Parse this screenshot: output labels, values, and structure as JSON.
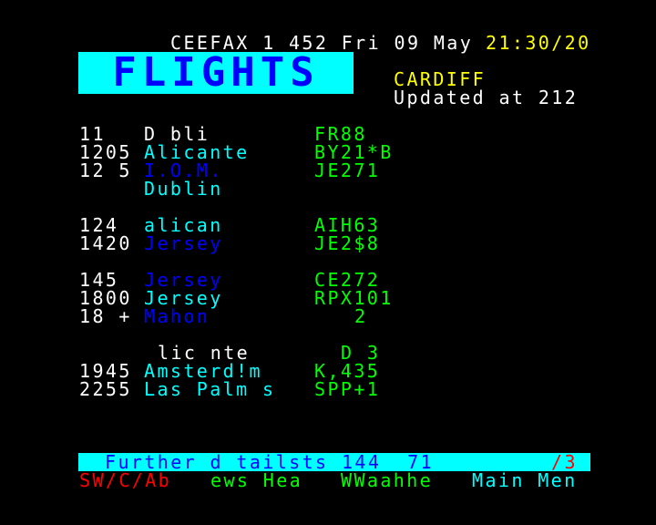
{
  "header": {
    "service": "CEEFAX 1 452 Fri 09 May",
    "time": "21:30/20"
  },
  "logo": {
    "text": "FLIGHTS"
  },
  "location": "CARDIFF",
  "updated": "Updated at 212",
  "colors": {
    "background": "#000000",
    "white": "#ffffff",
    "yellow": "#ffff00",
    "cyan": "#00ffff",
    "green": "#00ff00",
    "blue": "#0000ff",
    "red": "#ff0000"
  },
  "flights": [
    {
      "time": "11",
      "destination": "D bli",
      "flight": "FR88"
    },
    {
      "time": "1205",
      "destination": "Alicante",
      "flight": "BY21*B"
    },
    {
      "time": "12 5",
      "destination": "I.O.M.",
      "flight": "JE271"
    },
    {
      "time": "",
      "destination": "Dublin",
      "flight": ""
    },
    {
      "time": "124",
      "destination": "alican",
      "flight": "AIH63"
    },
    {
      "time": "1420",
      "destination": "Jersey",
      "flight": "JE2$8"
    },
    {
      "time": "145",
      "destination": "Jersey",
      "flight": "CE272"
    },
    {
      "time": "1800",
      "destination": "Jersey",
      "flight": "RPX101"
    },
    {
      "time": "18 +",
      "destination": "Mahon",
      "flight": "2"
    },
    {
      "time": "",
      "destination": "lic nte",
      "flight": "D 3"
    },
    {
      "time": "1945",
      "destination": "Amsterd!m",
      "flight": "K,435"
    },
    {
      "time": "2255",
      "destination": "Las Palm s",
      "flight": "SPP+1"
    }
  ],
  "footer": {
    "further": "Further d tailsts 144  71",
    "page_counter": "/3",
    "fastext": [
      "SW/C/Ab",
      "ews Hea",
      "WWaahhe",
      "Main Men"
    ]
  }
}
